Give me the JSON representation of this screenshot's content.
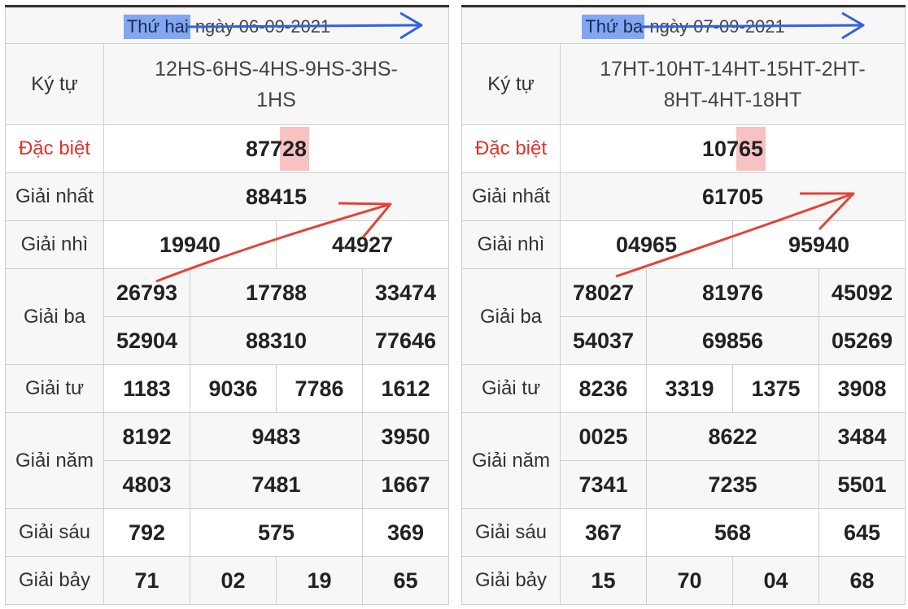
{
  "left": {
    "header": {
      "highlight": "Thứ hai",
      "rest": " ngày 06-09-2021"
    },
    "labels": {
      "ky_tu": "Ký tự",
      "db": "Đặc biệt",
      "g1": "Giải nhất",
      "g2": "Giải nhì",
      "g3": "Giải ba",
      "g4": "Giải tư",
      "g5": "Giải năm",
      "g6": "Giải sáu",
      "g7": "Giải bảy"
    },
    "ky_tu": [
      "12HS-6HS-4HS-9HS-3HS-",
      "1HS"
    ],
    "db": {
      "pre": "877",
      "mark": "28",
      "post": ""
    },
    "g1": "88415",
    "g2": [
      "19940",
      "44927"
    ],
    "g3_first": {
      "pre": "26",
      "mark": "7",
      "post": "93"
    },
    "g3": [
      "17788",
      "33474",
      "52904",
      "88310",
      "77646"
    ],
    "g4": [
      "1183",
      "9036",
      "7786",
      "1612"
    ],
    "g5": [
      "8192",
      "9483",
      "3950",
      "4803",
      "7481",
      "1667"
    ],
    "g6": [
      "792",
      "575",
      "369"
    ],
    "g7": [
      "71",
      "02",
      "19",
      "65"
    ]
  },
  "right": {
    "header": {
      "highlight": "Thứ ba",
      "rest": " ngày 07-09-2021"
    },
    "labels": {
      "ky_tu": "Ký tự",
      "db": "Đặc biệt",
      "g1": "Giải nhất",
      "g2": "Giải nhì",
      "g3": "Giải ba",
      "g4": "Giải tư",
      "g5": "Giải năm",
      "g6": "Giải sáu",
      "g7": "Giải bảy"
    },
    "ky_tu": [
      "17HT-10HT-14HT-15HT-2HT-",
      "8HT-4HT-18HT"
    ],
    "db": {
      "pre": "107",
      "mark": "65",
      "post": ""
    },
    "g1": "61705",
    "g2": [
      "04965",
      "95940"
    ],
    "g3_first": {
      "pre": "78",
      "mark": "0",
      "post": "27"
    },
    "g3": [
      "81976",
      "45092",
      "54037",
      "69856",
      "05269"
    ],
    "g4": [
      "8236",
      "3319",
      "1375",
      "3908"
    ],
    "g5": [
      "0025",
      "8622",
      "3484",
      "7341",
      "7235",
      "5501"
    ],
    "g6": [
      "367",
      "568",
      "645"
    ],
    "g7": [
      "15",
      "70",
      "04",
      "68"
    ]
  },
  "colors": {
    "accent_red": "#e0332b",
    "highlight_blue": "#5a8cf0",
    "annotation_arrow_red": "#e0443a",
    "annotation_arrow_blue": "#2f62e0"
  }
}
